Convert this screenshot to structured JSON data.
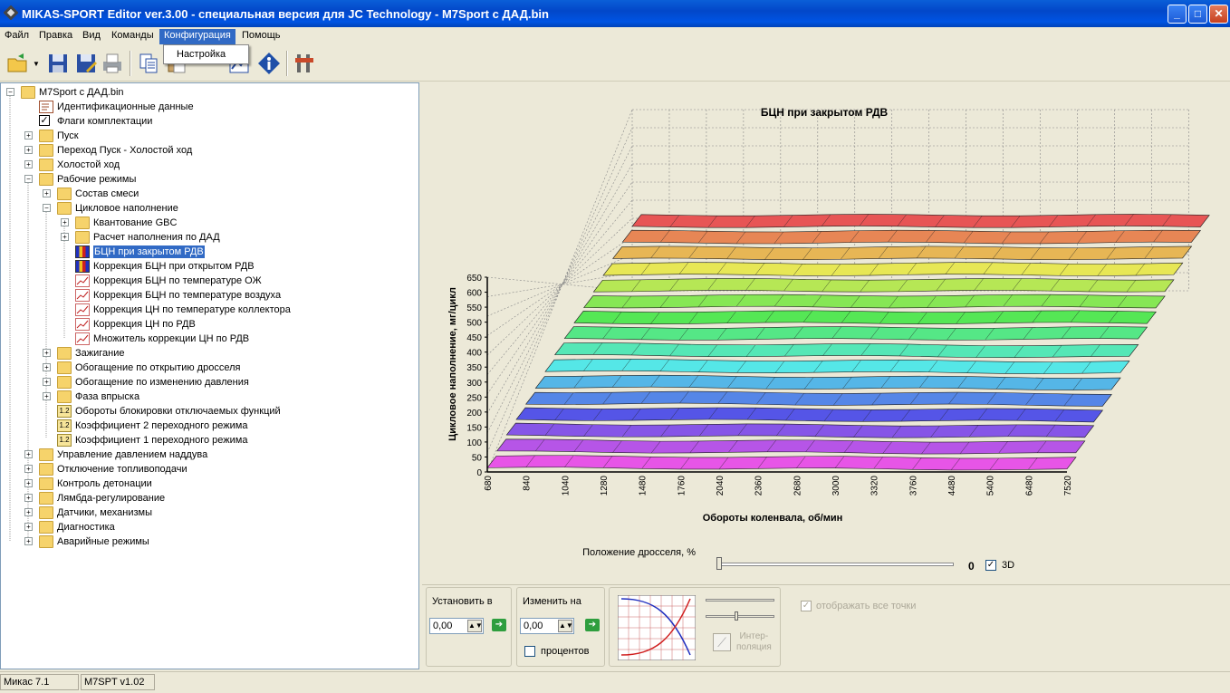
{
  "window": {
    "title": "MIKAS-SPORT Editor ver.3.00 - специальная версия для JC Technology - M7Sport с ДАД.bin",
    "min": "_",
    "max": "□",
    "close": "✕"
  },
  "menu": [
    "Файл",
    "Правка",
    "Вид",
    "Команды",
    "Конфигурация",
    "Помощь"
  ],
  "dropdown": {
    "item": "Настройка"
  },
  "tree": [
    {
      "label": "M7Sport с ДАД.bin",
      "level": 0,
      "exp": "-",
      "icon": "folder-open"
    },
    {
      "label": "Идентификационные данные",
      "level": 1,
      "exp": "",
      "icon": "doc-edit"
    },
    {
      "label": "Флаги комплектации",
      "level": 1,
      "exp": "",
      "icon": "checkbox"
    },
    {
      "label": "Пуск",
      "level": 1,
      "exp": "+",
      "icon": "folder"
    },
    {
      "label": "Переход Пуск - Холостой ход",
      "level": 1,
      "exp": "+",
      "icon": "folder"
    },
    {
      "label": "Холостой ход",
      "level": 1,
      "exp": "+",
      "icon": "folder"
    },
    {
      "label": "Рабочие режимы",
      "level": 1,
      "exp": "-",
      "icon": "folder-open"
    },
    {
      "label": "Состав смеси",
      "level": 2,
      "exp": "+",
      "icon": "folder"
    },
    {
      "label": "Цикловое наполнение",
      "level": 2,
      "exp": "-",
      "icon": "folder-open"
    },
    {
      "label": "Квантование GBC",
      "level": 3,
      "exp": "+",
      "icon": "folder"
    },
    {
      "label": "Расчет наполнения по ДАД",
      "level": 3,
      "exp": "+",
      "icon": "folder"
    },
    {
      "label": "БЦН при закрытом РДВ",
      "level": 3,
      "exp": "",
      "icon": "chart3d",
      "selected": true
    },
    {
      "label": "Коррекция БЦН при открытом РДВ",
      "level": 3,
      "exp": "",
      "icon": "chart3d"
    },
    {
      "label": "Коррекция БЦН по температуре ОЖ",
      "level": 3,
      "exp": "",
      "icon": "chart2d"
    },
    {
      "label": "Коррекция БЦН по температуре воздуха",
      "level": 3,
      "exp": "",
      "icon": "chart2d"
    },
    {
      "label": "Коррекция ЦН по температуре коллектора",
      "level": 3,
      "exp": "",
      "icon": "chart2d"
    },
    {
      "label": "Коррекция ЦН по РДВ",
      "level": 3,
      "exp": "",
      "icon": "chart2d"
    },
    {
      "label": "Множитель коррекции ЦН по РДВ",
      "level": 3,
      "exp": "",
      "icon": "chart2d"
    },
    {
      "label": "Зажигание",
      "level": 2,
      "exp": "+",
      "icon": "folder"
    },
    {
      "label": "Обогащение по открытию дросселя",
      "level": 2,
      "exp": "+",
      "icon": "folder"
    },
    {
      "label": "Обогащение по изменению давления",
      "level": 2,
      "exp": "+",
      "icon": "folder"
    },
    {
      "label": "Фаза впрыска",
      "level": 2,
      "exp": "+",
      "icon": "folder"
    },
    {
      "label": "Обороты блокировки отключаемых функций",
      "level": 2,
      "exp": "",
      "icon": "num"
    },
    {
      "label": "Коэффициент 2 переходного режима",
      "level": 2,
      "exp": "",
      "icon": "num"
    },
    {
      "label": "Коэффициент 1 переходного режима",
      "level": 2,
      "exp": "",
      "icon": "num"
    },
    {
      "label": "Управление давлением наддува",
      "level": 1,
      "exp": "+",
      "icon": "folder"
    },
    {
      "label": "Отключение топливоподачи",
      "level": 1,
      "exp": "+",
      "icon": "folder"
    },
    {
      "label": "Контроль детонации",
      "level": 1,
      "exp": "+",
      "icon": "folder"
    },
    {
      "label": "Лямбда-регулирование",
      "level": 1,
      "exp": "+",
      "icon": "folder"
    },
    {
      "label": "Датчики, механизмы",
      "level": 1,
      "exp": "+",
      "icon": "folder"
    },
    {
      "label": "Диагностика",
      "level": 1,
      "exp": "+",
      "icon": "folder"
    },
    {
      "label": "Аварийные режимы",
      "level": 1,
      "exp": "+",
      "icon": "folder"
    }
  ],
  "chart_data": {
    "type": "surface3d",
    "title": "БЦН при закрытом РДВ",
    "xlabel": "Обороты коленвала, об/мин",
    "ylabel": "Цикловое наполнение, мг/цикл",
    "x": [
      680,
      840,
      1040,
      1280,
      1480,
      1760,
      2040,
      2360,
      2680,
      3000,
      3320,
      3760,
      4480,
      5400,
      6480,
      7520
    ],
    "y_ticks": [
      0,
      50,
      100,
      150,
      200,
      250,
      300,
      350,
      400,
      450,
      500,
      550,
      600,
      650
    ],
    "ylim": [
      0,
      650
    ],
    "series_count": 16,
    "grid": true
  },
  "throttle": {
    "label": "Положение дросселя, %",
    "value": "0",
    "checkbox_label": "3D"
  },
  "panel": {
    "set_label": "Установить в",
    "set_value": "0,00",
    "change_label": "Изменить на",
    "change_value": "0,00",
    "percent_label": "процентов",
    "interp_label": "Интер-\nполяция",
    "show_all_label": "отображать все точки"
  },
  "status": {
    "left": "Микас 7.1",
    "right": "M7SPT v1.02"
  }
}
